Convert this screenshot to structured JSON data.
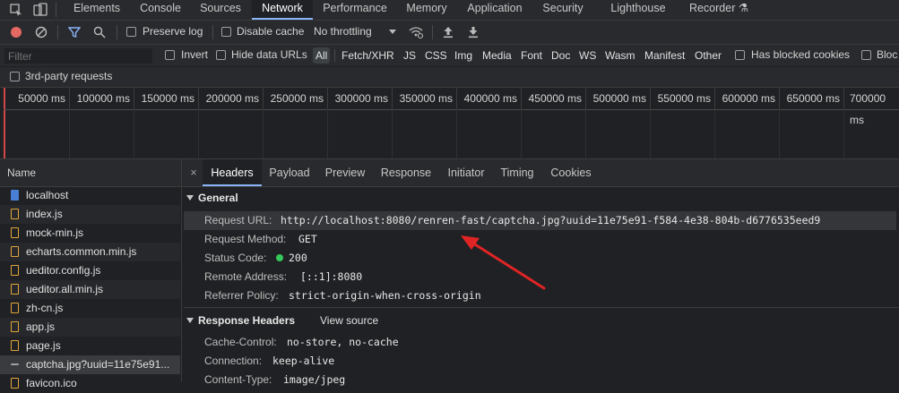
{
  "top_tabs": [
    "Elements",
    "Console",
    "Sources",
    "Network",
    "Performance",
    "Memory",
    "Application",
    "Security",
    "Lighthouse",
    "Recorder ⚗"
  ],
  "toolbar": {
    "preserve_log": "Preserve log",
    "disable_cache": "Disable cache",
    "throttling": "No throttling"
  },
  "filter": {
    "placeholder": "Filter",
    "invert": "Invert",
    "hide_data_urls": "Hide data URLs",
    "types": [
      "All",
      "Fetch/XHR",
      "JS",
      "CSS",
      "Img",
      "Media",
      "Font",
      "Doc",
      "WS",
      "Wasm",
      "Manifest",
      "Other"
    ],
    "has_blocked_cookies": "Has blocked cookies",
    "blocked_partial": "Bloc",
    "third_party": "3rd-party requests"
  },
  "timeline_ticks": [
    "50000 ms",
    "100000 ms",
    "150000 ms",
    "200000 ms",
    "250000 ms",
    "300000 ms",
    "350000 ms",
    "400000 ms",
    "450000 ms",
    "500000 ms",
    "550000 ms",
    "600000 ms",
    "650000 ms",
    "700000 ms"
  ],
  "requests": {
    "header": "Name",
    "items": [
      "localhost",
      "index.js",
      "mock-min.js",
      "echarts.common.min.js",
      "ueditor.config.js",
      "ueditor.all.min.js",
      "zh-cn.js",
      "app.js",
      "page.js",
      "captcha.jpg?uuid=11e75e91...",
      "favicon.ico"
    ]
  },
  "detail_tabs": [
    "×",
    "Headers",
    "Payload",
    "Preview",
    "Response",
    "Initiator",
    "Timing",
    "Cookies"
  ],
  "general": {
    "title": "General",
    "rows": [
      {
        "key": "Request URL:",
        "value": "http://localhost:8080/renren-fast/captcha.jpg?uuid=11e75e91-f584-4e38-804b-d6776535eed9"
      },
      {
        "key": "Request Method:",
        "value": "GET"
      },
      {
        "key": "Status Code:",
        "value": "200"
      },
      {
        "key": "Remote Address:",
        "value": "[::1]:8080"
      },
      {
        "key": "Referrer Policy:",
        "value": "strict-origin-when-cross-origin"
      }
    ]
  },
  "response_headers": {
    "title": "Response Headers",
    "view_source": "View source",
    "rows": [
      {
        "key": "Cache-Control:",
        "value": "no-store, no-cache"
      },
      {
        "key": "Connection:",
        "value": "keep-alive"
      },
      {
        "key": "Content-Type:",
        "value": "image/jpeg"
      }
    ]
  },
  "colors": {
    "accent": "#8ab4f8",
    "record": "#e46962",
    "status_ok": "#34c759",
    "arrow": "#e02424"
  }
}
